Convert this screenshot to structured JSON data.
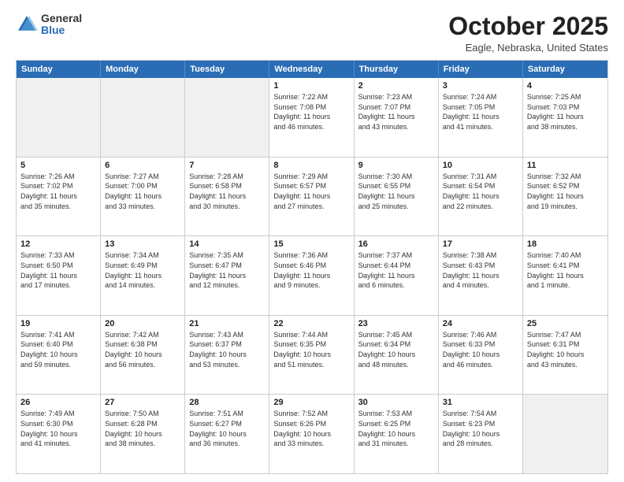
{
  "logo": {
    "general": "General",
    "blue": "Blue"
  },
  "title": "October 2025",
  "location": "Eagle, Nebraska, United States",
  "header_days": [
    "Sunday",
    "Monday",
    "Tuesday",
    "Wednesday",
    "Thursday",
    "Friday",
    "Saturday"
  ],
  "rows": [
    [
      {
        "day": "",
        "detail": ""
      },
      {
        "day": "",
        "detail": ""
      },
      {
        "day": "",
        "detail": ""
      },
      {
        "day": "1",
        "detail": "Sunrise: 7:22 AM\nSunset: 7:08 PM\nDaylight: 11 hours\nand 46 minutes."
      },
      {
        "day": "2",
        "detail": "Sunrise: 7:23 AM\nSunset: 7:07 PM\nDaylight: 11 hours\nand 43 minutes."
      },
      {
        "day": "3",
        "detail": "Sunrise: 7:24 AM\nSunset: 7:05 PM\nDaylight: 11 hours\nand 41 minutes."
      },
      {
        "day": "4",
        "detail": "Sunrise: 7:25 AM\nSunset: 7:03 PM\nDaylight: 11 hours\nand 38 minutes."
      }
    ],
    [
      {
        "day": "5",
        "detail": "Sunrise: 7:26 AM\nSunset: 7:02 PM\nDaylight: 11 hours\nand 35 minutes."
      },
      {
        "day": "6",
        "detail": "Sunrise: 7:27 AM\nSunset: 7:00 PM\nDaylight: 11 hours\nand 33 minutes."
      },
      {
        "day": "7",
        "detail": "Sunrise: 7:28 AM\nSunset: 6:58 PM\nDaylight: 11 hours\nand 30 minutes."
      },
      {
        "day": "8",
        "detail": "Sunrise: 7:29 AM\nSunset: 6:57 PM\nDaylight: 11 hours\nand 27 minutes."
      },
      {
        "day": "9",
        "detail": "Sunrise: 7:30 AM\nSunset: 6:55 PM\nDaylight: 11 hours\nand 25 minutes."
      },
      {
        "day": "10",
        "detail": "Sunrise: 7:31 AM\nSunset: 6:54 PM\nDaylight: 11 hours\nand 22 minutes."
      },
      {
        "day": "11",
        "detail": "Sunrise: 7:32 AM\nSunset: 6:52 PM\nDaylight: 11 hours\nand 19 minutes."
      }
    ],
    [
      {
        "day": "12",
        "detail": "Sunrise: 7:33 AM\nSunset: 6:50 PM\nDaylight: 11 hours\nand 17 minutes."
      },
      {
        "day": "13",
        "detail": "Sunrise: 7:34 AM\nSunset: 6:49 PM\nDaylight: 11 hours\nand 14 minutes."
      },
      {
        "day": "14",
        "detail": "Sunrise: 7:35 AM\nSunset: 6:47 PM\nDaylight: 11 hours\nand 12 minutes."
      },
      {
        "day": "15",
        "detail": "Sunrise: 7:36 AM\nSunset: 6:46 PM\nDaylight: 11 hours\nand 9 minutes."
      },
      {
        "day": "16",
        "detail": "Sunrise: 7:37 AM\nSunset: 6:44 PM\nDaylight: 11 hours\nand 6 minutes."
      },
      {
        "day": "17",
        "detail": "Sunrise: 7:38 AM\nSunset: 6:43 PM\nDaylight: 11 hours\nand 4 minutes."
      },
      {
        "day": "18",
        "detail": "Sunrise: 7:40 AM\nSunset: 6:41 PM\nDaylight: 11 hours\nand 1 minute."
      }
    ],
    [
      {
        "day": "19",
        "detail": "Sunrise: 7:41 AM\nSunset: 6:40 PM\nDaylight: 10 hours\nand 59 minutes."
      },
      {
        "day": "20",
        "detail": "Sunrise: 7:42 AM\nSunset: 6:38 PM\nDaylight: 10 hours\nand 56 minutes."
      },
      {
        "day": "21",
        "detail": "Sunrise: 7:43 AM\nSunset: 6:37 PM\nDaylight: 10 hours\nand 53 minutes."
      },
      {
        "day": "22",
        "detail": "Sunrise: 7:44 AM\nSunset: 6:35 PM\nDaylight: 10 hours\nand 51 minutes."
      },
      {
        "day": "23",
        "detail": "Sunrise: 7:45 AM\nSunset: 6:34 PM\nDaylight: 10 hours\nand 48 minutes."
      },
      {
        "day": "24",
        "detail": "Sunrise: 7:46 AM\nSunset: 6:33 PM\nDaylight: 10 hours\nand 46 minutes."
      },
      {
        "day": "25",
        "detail": "Sunrise: 7:47 AM\nSunset: 6:31 PM\nDaylight: 10 hours\nand 43 minutes."
      }
    ],
    [
      {
        "day": "26",
        "detail": "Sunrise: 7:49 AM\nSunset: 6:30 PM\nDaylight: 10 hours\nand 41 minutes."
      },
      {
        "day": "27",
        "detail": "Sunrise: 7:50 AM\nSunset: 6:28 PM\nDaylight: 10 hours\nand 38 minutes."
      },
      {
        "day": "28",
        "detail": "Sunrise: 7:51 AM\nSunset: 6:27 PM\nDaylight: 10 hours\nand 36 minutes."
      },
      {
        "day": "29",
        "detail": "Sunrise: 7:52 AM\nSunset: 6:26 PM\nDaylight: 10 hours\nand 33 minutes."
      },
      {
        "day": "30",
        "detail": "Sunrise: 7:53 AM\nSunset: 6:25 PM\nDaylight: 10 hours\nand 31 minutes."
      },
      {
        "day": "31",
        "detail": "Sunrise: 7:54 AM\nSunset: 6:23 PM\nDaylight: 10 hours\nand 28 minutes."
      },
      {
        "day": "",
        "detail": ""
      }
    ]
  ]
}
